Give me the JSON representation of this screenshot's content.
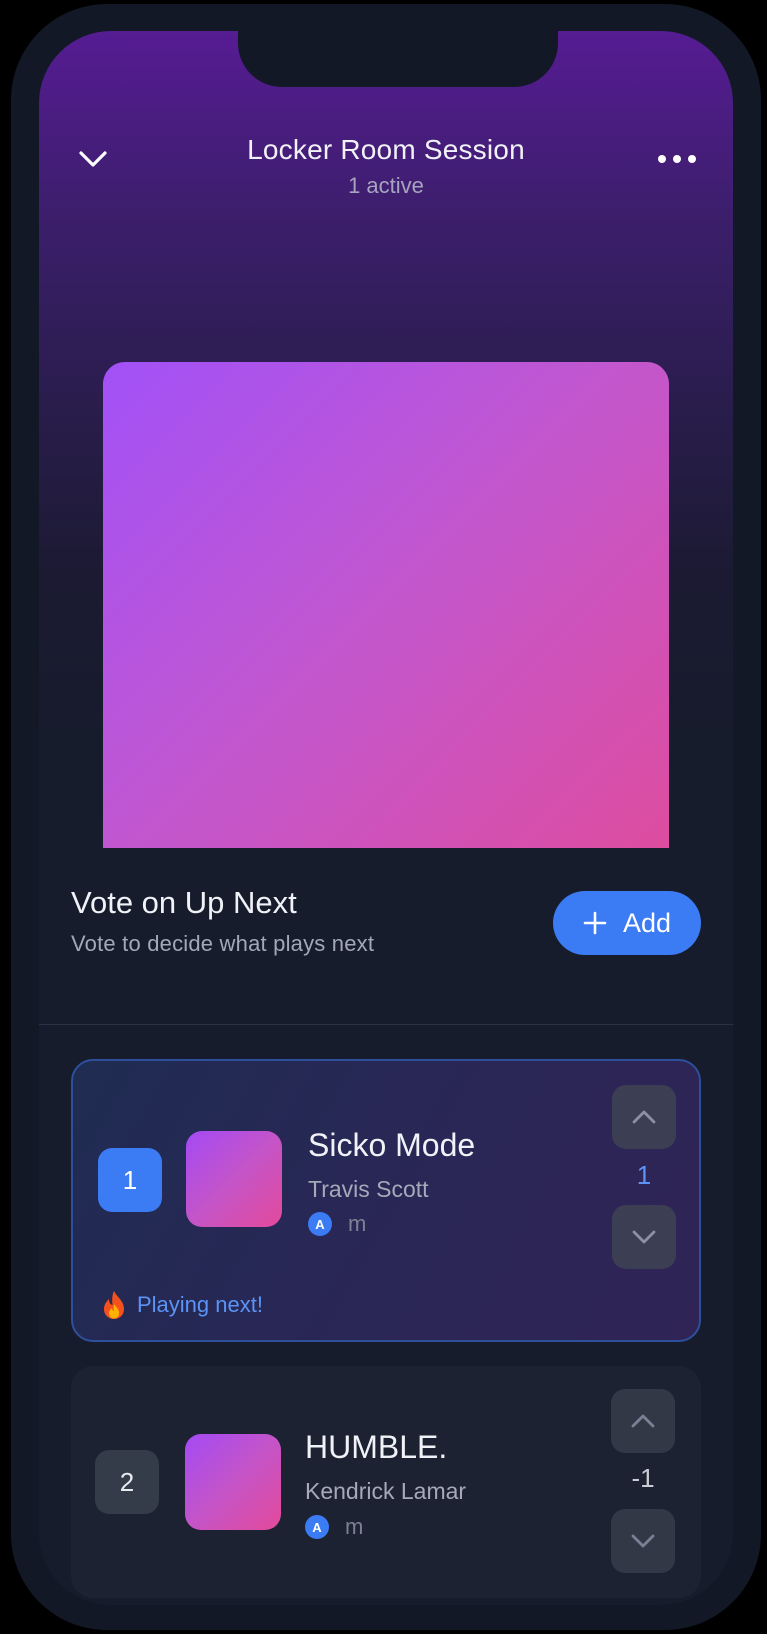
{
  "header": {
    "title": "Locker Room Session",
    "active": "1 active"
  },
  "queue": {
    "title": "Vote on Up Next",
    "subtitle": "Vote to decide what plays next",
    "add_label": "Add",
    "items": [
      {
        "rank": "1",
        "title": "Sicko Mode",
        "artist": "Travis Scott",
        "avatar_initial": "A",
        "added_by": "m",
        "score": "1",
        "status": "Playing next!"
      },
      {
        "rank": "2",
        "title": "HUMBLE.",
        "artist": "Kendrick Lamar",
        "avatar_initial": "A",
        "added_by": "m",
        "score": "-1"
      }
    ]
  },
  "colors": {
    "accent": "#3b7bf3",
    "background": "#161c2b",
    "hero_top": "#561c93",
    "art_start": "#a251f8",
    "art_end": "#e14b98"
  },
  "icons": {
    "back": "chevron-down-icon",
    "more": "more-horizontal-icon",
    "add": "plus-icon",
    "upvote": "chevron-up-icon",
    "downvote": "chevron-down-icon",
    "status": "fire-icon"
  }
}
